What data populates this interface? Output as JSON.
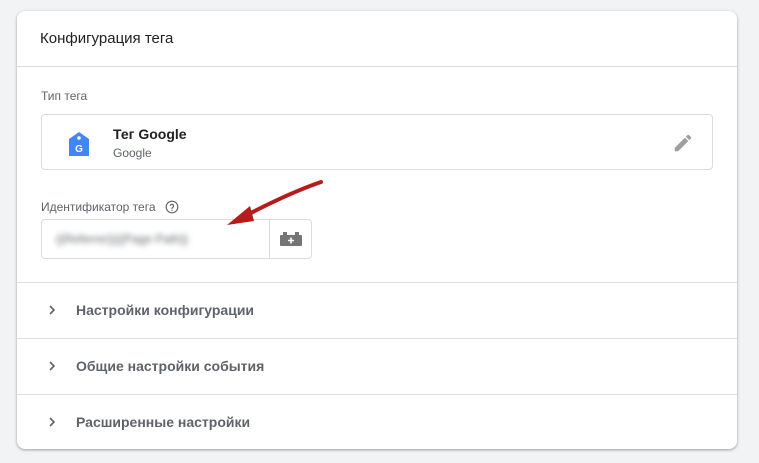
{
  "header": {
    "title": "Конфигурация тега"
  },
  "tag_type": {
    "label": "Тип тега",
    "name": "Тег Google",
    "vendor": "Google",
    "icon": "google-tag-icon",
    "icon_letter": "G",
    "accent": "#4285f4"
  },
  "tag_id": {
    "label": "Идентификатор тега",
    "value": "{{Referrer}}{{Page Path}}",
    "help_icon": "help-icon",
    "variable_icon": "variable-icon"
  },
  "annotation": {
    "arrow_color": "#b71c1c"
  },
  "sections": [
    {
      "label": "Настройки конфигурации"
    },
    {
      "label": "Общие настройки события"
    },
    {
      "label": "Расширенные настройки"
    }
  ]
}
